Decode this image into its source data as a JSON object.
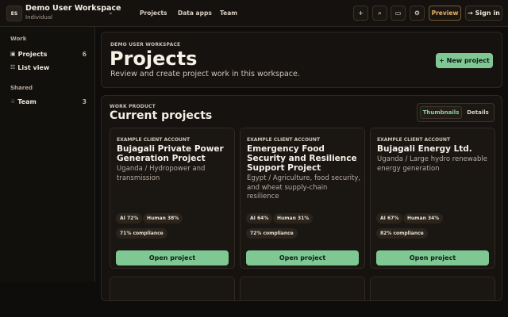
{
  "workspace": {
    "logo": "ES",
    "name": "Demo User Workspace",
    "subtitle": "Individual"
  },
  "nav": [
    "Projects",
    "Data apps",
    "Team"
  ],
  "toolbar": {
    "add_icon": "+",
    "search_icon": "⌕",
    "panel_icon": "▭",
    "settings_icon": "⚙",
    "preview_label": "Preview",
    "signin_label": "→ Sign in"
  },
  "sidebar": {
    "sections": [
      {
        "label": "Work",
        "items": [
          {
            "icon": "▣",
            "label": "Projects",
            "count": "6"
          },
          {
            "icon": "☷",
            "label": "List view",
            "count": ""
          }
        ]
      },
      {
        "label": "Shared",
        "items": [
          {
            "icon": "♤",
            "label": "Team",
            "count": "3"
          }
        ]
      }
    ]
  },
  "header": {
    "eyebrow": "DEMO USER WORKSPACE",
    "title": "Projects",
    "description": "Review and create project work in this workspace.",
    "new_button": "+ New project"
  },
  "projects": {
    "eyebrow": "WORK PRODUCT",
    "title": "Current projects",
    "view_options": [
      "Thumbnails",
      "Details"
    ],
    "active_view": "Thumbnails",
    "cards": [
      {
        "eyebrow": "EXAMPLE CLIENT ACCOUNT",
        "title": "Bujagali Private Power Generation Project",
        "description": "Uganda / Hydropower and transmission",
        "ai": "AI 72%",
        "human": "Human 38%",
        "compliance": "71% compliance",
        "open_label": "Open project"
      },
      {
        "eyebrow": "EXAMPLE CLIENT ACCOUNT",
        "title": "Emergency Food Security and Resilience Support Project",
        "description": "Egypt / Agriculture, food security, and wheat supply-chain resilience",
        "ai": "AI 64%",
        "human": "Human 31%",
        "compliance": "72% compliance",
        "open_label": "Open project"
      },
      {
        "eyebrow": "EXAMPLE CLIENT ACCOUNT",
        "title": "Bujagali Energy Ltd.",
        "description": "Uganda / Large hydro renewable energy generation",
        "ai": "AI 67%",
        "human": "Human 34%",
        "compliance": "82% compliance",
        "open_label": "Open project"
      }
    ]
  },
  "colors": {
    "accent_green": "#7fc894",
    "preview_orange": "#e9b16a",
    "background": "#0f0d0b"
  }
}
